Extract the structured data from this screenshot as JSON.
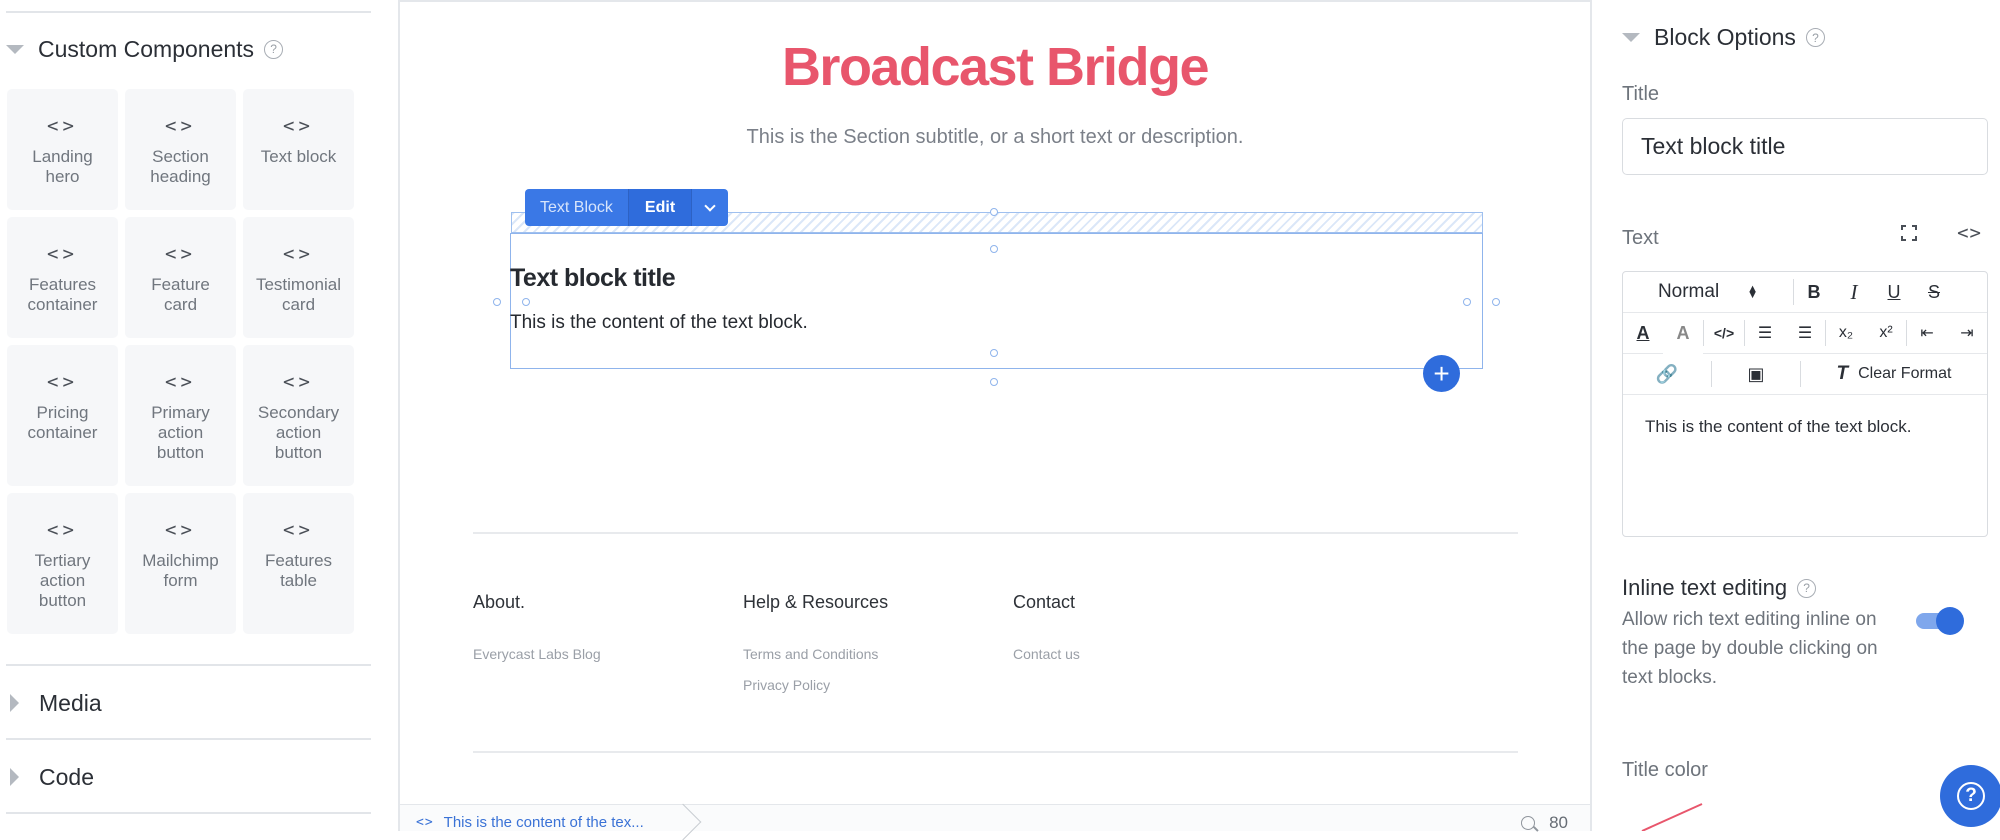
{
  "left_panel": {
    "custom_components": {
      "title": "Custom Components",
      "help": "?",
      "items": [
        {
          "icon": "<>",
          "label": "Landing hero"
        },
        {
          "icon": "<>",
          "label": "Section heading"
        },
        {
          "icon": "<>",
          "label": "Text block"
        },
        {
          "icon": "<>",
          "label": "Features container"
        },
        {
          "icon": "<>",
          "label": "Feature card"
        },
        {
          "icon": "<>",
          "label": "Testimonial card"
        },
        {
          "icon": "<>",
          "label": "Pricing container"
        },
        {
          "icon": "<>",
          "label": "Primary action button"
        },
        {
          "icon": "<>",
          "label": "Secondary action button"
        },
        {
          "icon": "<>",
          "label": "Tertiary action button"
        },
        {
          "icon": "<>",
          "label": "Mailchimp form"
        },
        {
          "icon": "<>",
          "label": "Features table"
        }
      ]
    },
    "media": {
      "title": "Media"
    },
    "code": {
      "title": "Code"
    }
  },
  "canvas": {
    "title": "Broadcast Bridge",
    "subtitle": "This is the Section subtitle, or a short text or description.",
    "block_toolbar": {
      "name": "Text Block",
      "edit": "Edit"
    },
    "block": {
      "title": "Text block title",
      "text": "This is the content of the text block."
    },
    "footer": {
      "columns": [
        {
          "heading": "About.",
          "links": [
            "Everycast Labs Blog"
          ]
        },
        {
          "heading": "Help & Resources",
          "links": [
            "Terms and Conditions",
            "Privacy Policy"
          ]
        },
        {
          "heading": "Contact",
          "links": [
            "Contact us"
          ]
        }
      ]
    },
    "status_bar": {
      "breadcrumb": "This is the content of the tex...",
      "zoom": "80"
    }
  },
  "right_panel": {
    "title": "Block Options",
    "help": "?",
    "title_label": "Title",
    "title_value": "Text block title",
    "text_label": "Text",
    "editor": {
      "format_select": "Normal",
      "bold": "B",
      "italic": "I",
      "underline": "U",
      "strike": "S",
      "clear_format": "Clear Format",
      "content": "This is the content of the text block."
    },
    "inline_editing": {
      "title": "Inline text editing",
      "help": "?",
      "description": "Allow rich text editing inline on the page by double clicking on text blocks.",
      "enabled": true
    },
    "title_color_label": "Title color",
    "colors": {
      "accent": "#2f6cdc",
      "title": "#e8566c",
      "swatch": "#e8566c"
    }
  }
}
